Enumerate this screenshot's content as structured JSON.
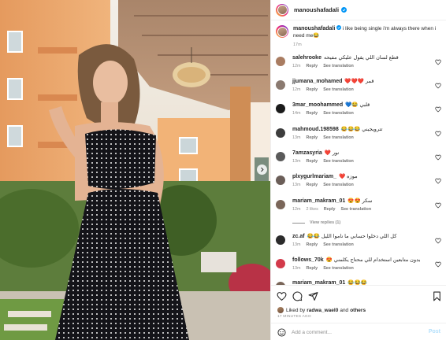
{
  "post": {
    "author": "manoushafadali",
    "verified": true,
    "caption_author": "manoushafadali",
    "caption_text": "i like being single i'm always there when i need me😂",
    "caption_time": "17m",
    "icon_verified": "verified-badge-icon"
  },
  "comments": [
    {
      "user": "salehrooke",
      "text": "قطع لسان اللي يقول عليكي مفيحه",
      "time": "12m",
      "reply": "Reply",
      "translate": "See translation",
      "avatar": "#a97c61"
    },
    {
      "user": "jjumana_mohamed",
      "text": "❤️❤️❤️ قمر",
      "time": "12m",
      "reply": "Reply",
      "translate": "See translation",
      "avatar": "#8b7a70"
    },
    {
      "user": "3mar_moohammed",
      "text": "💙😂 قلبي",
      "time": "14m",
      "reply": "Reply",
      "translate": "See translation",
      "avatar": "#1b1b1b"
    },
    {
      "user": "mahmoud.198598",
      "text": "😂😂😂 تترويجيني",
      "time": "13m",
      "reply": "Reply",
      "translate": "See translation",
      "avatar": "#3d3d3d"
    },
    {
      "user": "7amzasyria",
      "text": "❤️ نور",
      "time": "13m",
      "reply": "Reply",
      "translate": "See translation",
      "avatar": "#5a5a5a"
    },
    {
      "user": "plxygurlmariam_",
      "text": "❤️ موزه",
      "time": "13m",
      "reply": "Reply",
      "translate": "See translation",
      "avatar": "#6b5e58"
    },
    {
      "user": "mariam_makram_01",
      "text": "😍😍 سكر",
      "time": "12m",
      "likes": "2 likes",
      "reply": "Reply",
      "translate": "See translation",
      "avatar": "#7a6659"
    },
    {
      "user": "zc.af",
      "text": "😂😂 كل اللي دخلوا حسابي ما ناموا الليل",
      "time": "13m",
      "reply": "Reply",
      "translate": "See translation",
      "avatar": "#2b2b2b"
    },
    {
      "user": "follows_70k",
      "text": "😍 بدون متابعين استخدام للي محتاج يكلمني",
      "time": "13m",
      "reply": "Reply",
      "translate": "See translation",
      "avatar": "#d33a4a"
    },
    {
      "user": "mariam_makram_01",
      "text": "😂😂😂",
      "time": "",
      "reply": "",
      "translate": "",
      "avatar": "#7a6659"
    }
  ],
  "view_replies": "View replies (1)",
  "actions": {
    "liked_prefix": "Liked by",
    "liked_user": "radwa_wael0",
    "liked_and": "and",
    "liked_others": "others",
    "date": "17 MINUTES AGO",
    "icons": [
      "heart-icon",
      "comment-icon",
      "share-icon",
      "bookmark-icon"
    ]
  },
  "compose": {
    "placeholder": "Add a comment...",
    "post_label": "Post",
    "icon": "emoji-icon"
  },
  "colors": {
    "accent": "#0095f6",
    "post_disabled": "#b2dffc",
    "muted": "#8e8e8e",
    "verified": "#0095f6"
  }
}
